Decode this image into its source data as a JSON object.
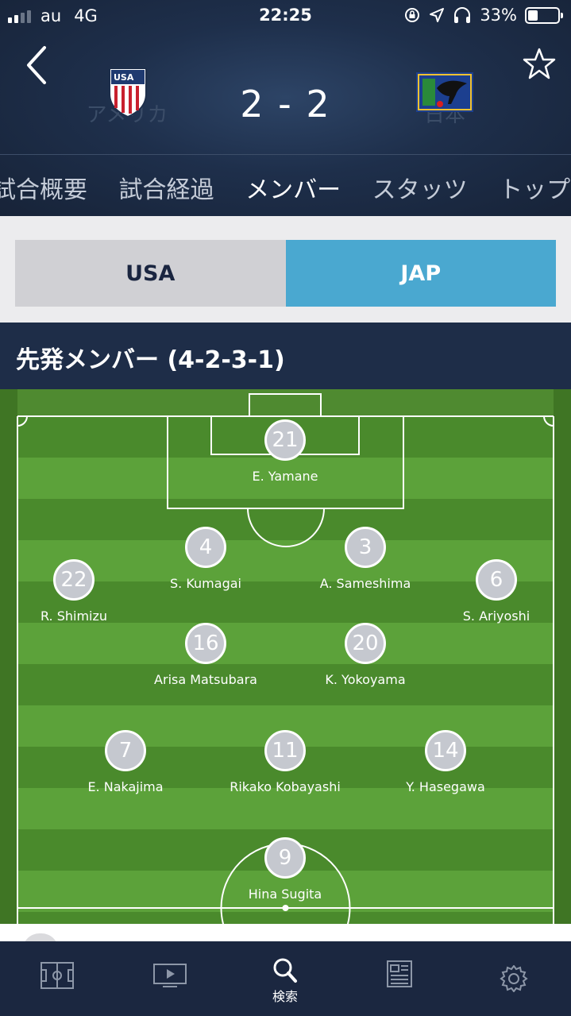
{
  "status_bar": {
    "carrier": "au",
    "network": "4G",
    "time": "22:25",
    "battery_percent": "33%",
    "battery_level": 0.33,
    "signal_bars_on": 2,
    "icons": [
      "rotation-lock-icon",
      "location-icon",
      "headphones-icon"
    ]
  },
  "header": {
    "back_icon": "chevron-left-icon",
    "favorite_icon": "star-outline-icon",
    "home_team": "アメリカ",
    "away_team": "日本",
    "score": "2 - 2",
    "home_crest": "usa-crest-icon",
    "away_crest": "japan-crest-icon"
  },
  "tabs": [
    {
      "label": "試合概要",
      "active": false
    },
    {
      "label": "試合経過",
      "active": false
    },
    {
      "label": "メンバー",
      "active": true
    },
    {
      "label": "スタッツ",
      "active": false
    },
    {
      "label": "トッププ",
      "active": false
    }
  ],
  "team_toggle": {
    "left": "USA",
    "right": "JAP",
    "selected": "JAP",
    "colors": {
      "selected": "#4aa8d0",
      "unselected": "#d0d0d4"
    }
  },
  "lineup": {
    "title": "先発メンバー (4-2-3-1)"
  },
  "players": [
    {
      "number": "21",
      "name": "E. Yamane"
    },
    {
      "number": "4",
      "name": "S. Kumagai"
    },
    {
      "number": "3",
      "name": "A. Sameshima"
    },
    {
      "number": "22",
      "name": "R. Shimizu"
    },
    {
      "number": "6",
      "name": "S. Ariyoshi"
    },
    {
      "number": "16",
      "name": "Arisa Matsubara"
    },
    {
      "number": "20",
      "name": "K. Yokoyama"
    },
    {
      "number": "7",
      "name": "E. Nakajima"
    },
    {
      "number": "11",
      "name": "Rikako Kobayashi"
    },
    {
      "number": "14",
      "name": "Y. Hasegawa"
    },
    {
      "number": "9",
      "name": "Hina Sugita"
    }
  ],
  "bottom_nav": [
    {
      "icon": "pitch-icon",
      "label": ""
    },
    {
      "icon": "tv-icon",
      "label": ""
    },
    {
      "icon": "search-icon",
      "label": "検索",
      "active": true
    },
    {
      "icon": "news-icon",
      "label": ""
    },
    {
      "icon": "gear-icon",
      "label": ""
    }
  ]
}
